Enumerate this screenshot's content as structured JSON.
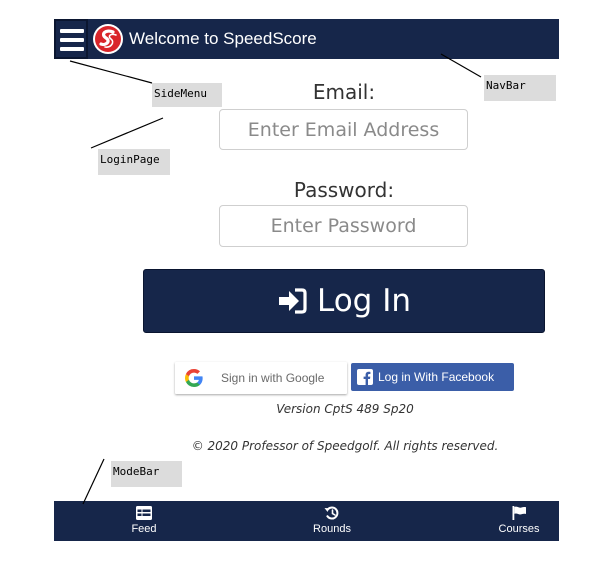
{
  "navbar": {
    "title": "Welcome to SpeedScore",
    "background_color": "#16264a",
    "menu_icon": "hamburger-menu-icon",
    "logo_icon": "speedscore-logo-icon"
  },
  "login": {
    "email_label": "Email:",
    "email_placeholder": "Enter Email Address",
    "email_value": "",
    "password_label": "Password:",
    "password_placeholder": "Enter Password",
    "password_value": "",
    "login_button_label": "Log In",
    "login_icon": "sign-in-icon",
    "google_button_label": "Sign in with Google",
    "google_icon": "google-g-icon",
    "facebook_button_label": "Log in With Facebook",
    "facebook_icon": "facebook-f-icon",
    "facebook_color": "#3b5ea8",
    "version": "Version CptS 489 Sp20",
    "copyright": "© 2020 Professor of Speedgolf. All rights reserved."
  },
  "modebar": {
    "tabs": [
      {
        "label": "Feed",
        "icon": "table-list-icon"
      },
      {
        "label": "Rounds",
        "icon": "history-icon"
      },
      {
        "label": "Courses",
        "icon": "flag-icon"
      }
    ]
  },
  "annotations": {
    "side_menu": "SideMenu",
    "nav_bar": "NavBar",
    "login_page": "LoginPage",
    "mode_bar": "ModeBar"
  }
}
